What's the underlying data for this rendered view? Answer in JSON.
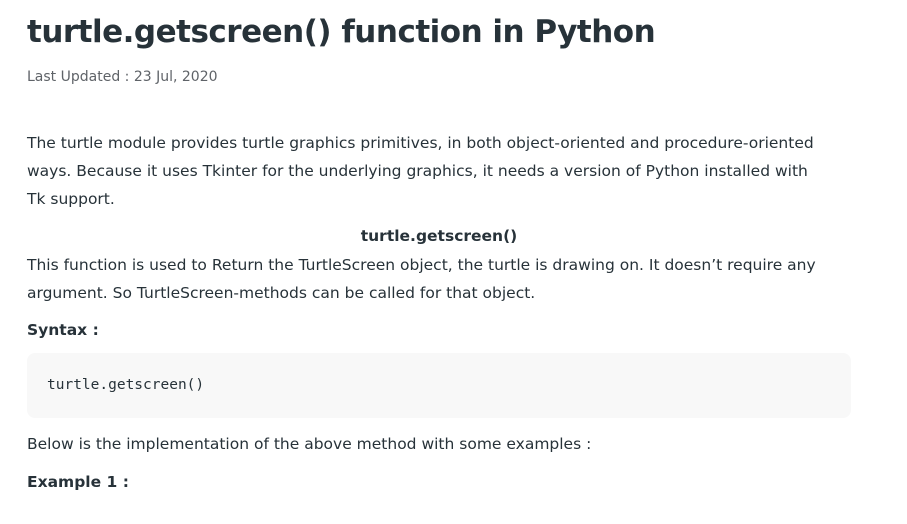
{
  "article": {
    "title": "turtle.getscreen() function in Python",
    "last_updated": "Last Updated : 23 Jul, 2020",
    "intro": "The turtle module provides turtle graphics primitives, in both object-oriented and procedure-oriented ways. Because it uses Tkinter for the underlying graphics, it needs a version of Python installed with Tk support.",
    "function_heading": "turtle.getscreen()",
    "description": "This function is used to Return the TurtleScreen object, the turtle is drawing on.  It doesn’t require any argument. So TurtleScreen-methods can be called for that object.",
    "syntax_label": "Syntax :",
    "syntax_code": "turtle.getscreen()",
    "implementation_text": "Below is the implementation of the above method with some examples :",
    "example_label": "Example 1 :"
  }
}
